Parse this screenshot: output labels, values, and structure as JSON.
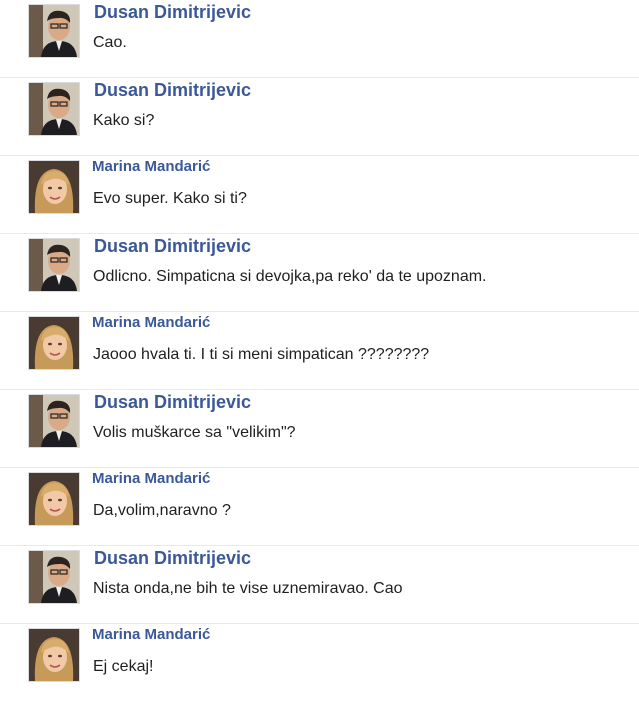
{
  "messages": [
    {
      "sender": "Dusan Dimitrijevic",
      "avatar": "male-avatar",
      "text": "Cao."
    },
    {
      "sender": "Dusan Dimitrijevic",
      "avatar": "male-avatar",
      "text": "Kako si?"
    },
    {
      "sender": "Marina Mandarić",
      "avatar": "female-avatar",
      "text": "Evo super. Kako si ti?"
    },
    {
      "sender": "Dusan Dimitrijevic",
      "avatar": "male-avatar",
      "text": "Odlicno. Simpaticna si devojka,pa reko' da te upoznam."
    },
    {
      "sender": "Marina Mandarić",
      "avatar": "female-avatar",
      "text": "Jaooo hvala ti. I ti si meni simpatican ????????"
    },
    {
      "sender": "Dusan Dimitrijevic",
      "avatar": "male-avatar",
      "text": "Volis muškarce sa \"velikim\"?"
    },
    {
      "sender": "Marina Mandarić",
      "avatar": "female-avatar",
      "text": "Da,volim,naravno ?"
    },
    {
      "sender": "Dusan Dimitrijevic",
      "avatar": "male-avatar",
      "text": "Nista onda,ne bih te vise uznemiravao. Cao"
    },
    {
      "sender": "Marina Mandarić",
      "avatar": "female-avatar",
      "text": "Ej cekaj!"
    }
  ],
  "colors": {
    "sender_name": "#3b5998",
    "message_text": "#1f1f1f",
    "divider": "#e6e9ee"
  }
}
